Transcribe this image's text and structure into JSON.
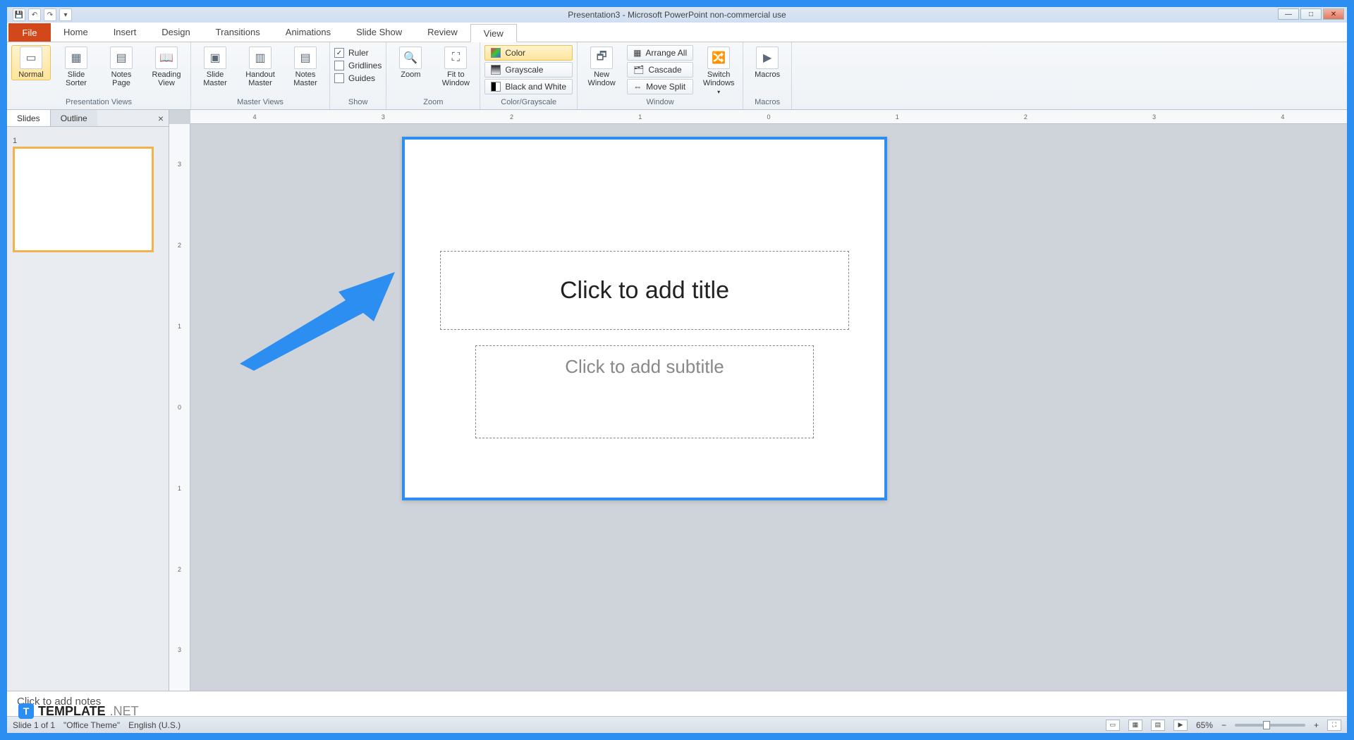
{
  "titlebar": {
    "title": "Presentation3 - Microsoft PowerPoint non-commercial use"
  },
  "tabs": {
    "file": "File",
    "items": [
      "Home",
      "Insert",
      "Design",
      "Transitions",
      "Animations",
      "Slide Show",
      "Review",
      "View"
    ],
    "active": "View"
  },
  "ribbon": {
    "presentation_views": {
      "label": "Presentation Views",
      "normal": "Normal",
      "slide_sorter": "Slide\nSorter",
      "notes_page": "Notes\nPage",
      "reading_view": "Reading\nView"
    },
    "master_views": {
      "label": "Master Views",
      "slide_master": "Slide\nMaster",
      "handout_master": "Handout\nMaster",
      "notes_master": "Notes\nMaster"
    },
    "show": {
      "label": "Show",
      "ruler": "Ruler",
      "gridlines": "Gridlines",
      "guides": "Guides"
    },
    "zoom": {
      "label": "Zoom",
      "zoom": "Zoom",
      "fit": "Fit to\nWindow"
    },
    "color": {
      "label": "Color/Grayscale",
      "color": "Color",
      "grayscale": "Grayscale",
      "bw": "Black and White"
    },
    "window": {
      "label": "Window",
      "new_window": "New\nWindow",
      "arrange_all": "Arrange All",
      "cascade": "Cascade",
      "move_split": "Move Split",
      "switch": "Switch\nWindows"
    },
    "macros": {
      "label": "Macros",
      "macros": "Macros"
    }
  },
  "left_pane": {
    "slides_tab": "Slides",
    "outline_tab": "Outline",
    "thumb_number": "1"
  },
  "slide": {
    "title_placeholder": "Click to add title",
    "subtitle_placeholder": "Click to add subtitle"
  },
  "hruler_ticks": [
    "4",
    "3",
    "2",
    "1",
    "0",
    "1",
    "2",
    "3",
    "4"
  ],
  "vruler_ticks": [
    "3",
    "2",
    "1",
    "0",
    "1",
    "2",
    "3"
  ],
  "notes": {
    "placeholder": "Click to add notes"
  },
  "statusbar": {
    "slide_of": "Slide 1 of 1",
    "theme": "\"Office Theme\"",
    "lang": "English (U.S.)",
    "zoom": "65%"
  },
  "watermark": {
    "brand": "TEMPLATE",
    "suffix": ".NET"
  }
}
